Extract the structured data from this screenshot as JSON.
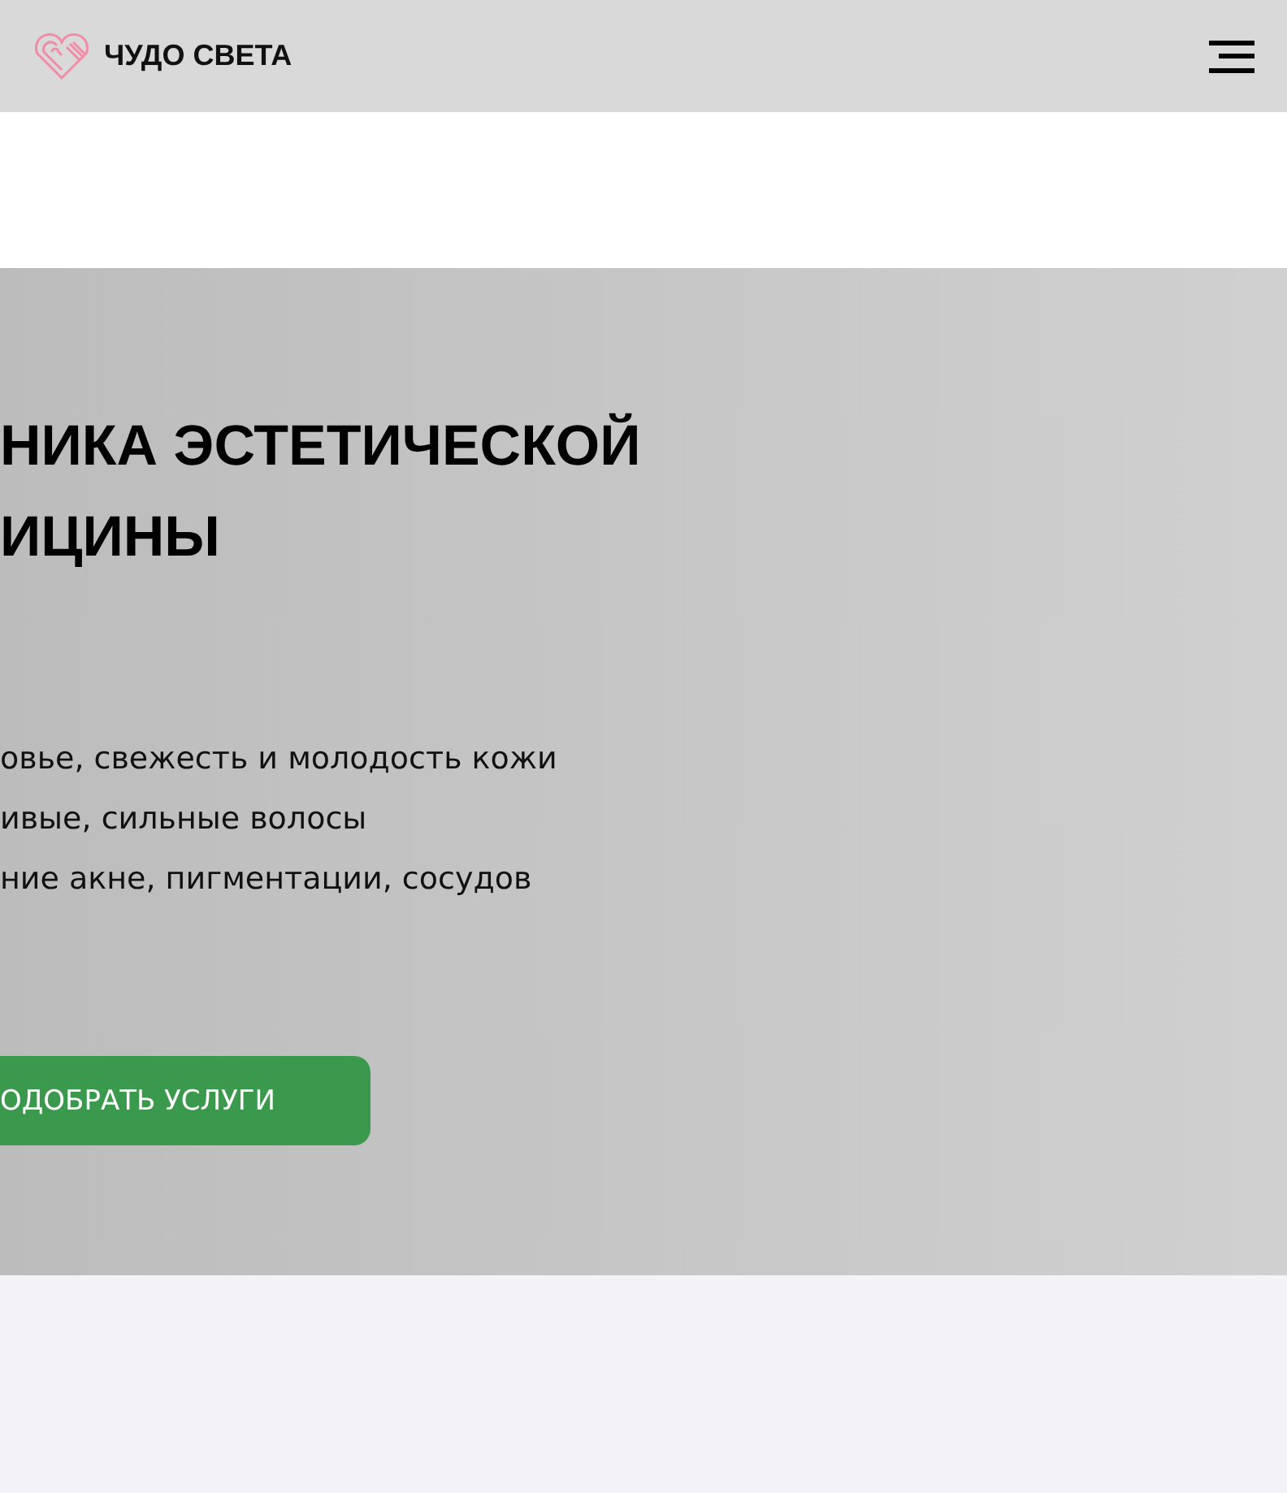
{
  "header": {
    "logo_text": "ЧУДО СВЕТА"
  },
  "hero": {
    "title_lines": [
      "НИКА ЭСТЕТИЧЕСКОЙ",
      "ИЦИНЫ"
    ],
    "benefits": [
      "овье, свежесть и молодость кожи",
      "ивые, сильные волосы",
      "ние акне, пигментации, сосудов"
    ],
    "button": "ОДОБРАТЬ УСЛУГИ"
  }
}
